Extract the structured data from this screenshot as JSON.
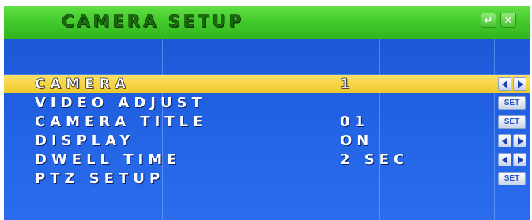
{
  "header": {
    "title": "CAMERA SETUP",
    "back_icon": "return-arrow-icon",
    "close_icon": "close-x-icon",
    "accent_color": "#40c72a"
  },
  "menu": {
    "selected_index": 0,
    "items": [
      {
        "label": "CAMERA",
        "value": "1",
        "control": "arrows"
      },
      {
        "label": "VIDEO ADJUST",
        "value": "",
        "control": "set"
      },
      {
        "label": "CAMERA TITLE",
        "value": "01",
        "control": "set"
      },
      {
        "label": "DISPLAY",
        "value": "ON",
        "control": "arrows"
      },
      {
        "label": "DWELL TIME",
        "value": "2 SEC",
        "control": "arrows"
      },
      {
        "label": "PTZ SETUP",
        "value": "",
        "control": "set"
      }
    ],
    "set_label": "SET",
    "highlight_color": "#f0c928",
    "background_color": "#1f5fe0"
  }
}
